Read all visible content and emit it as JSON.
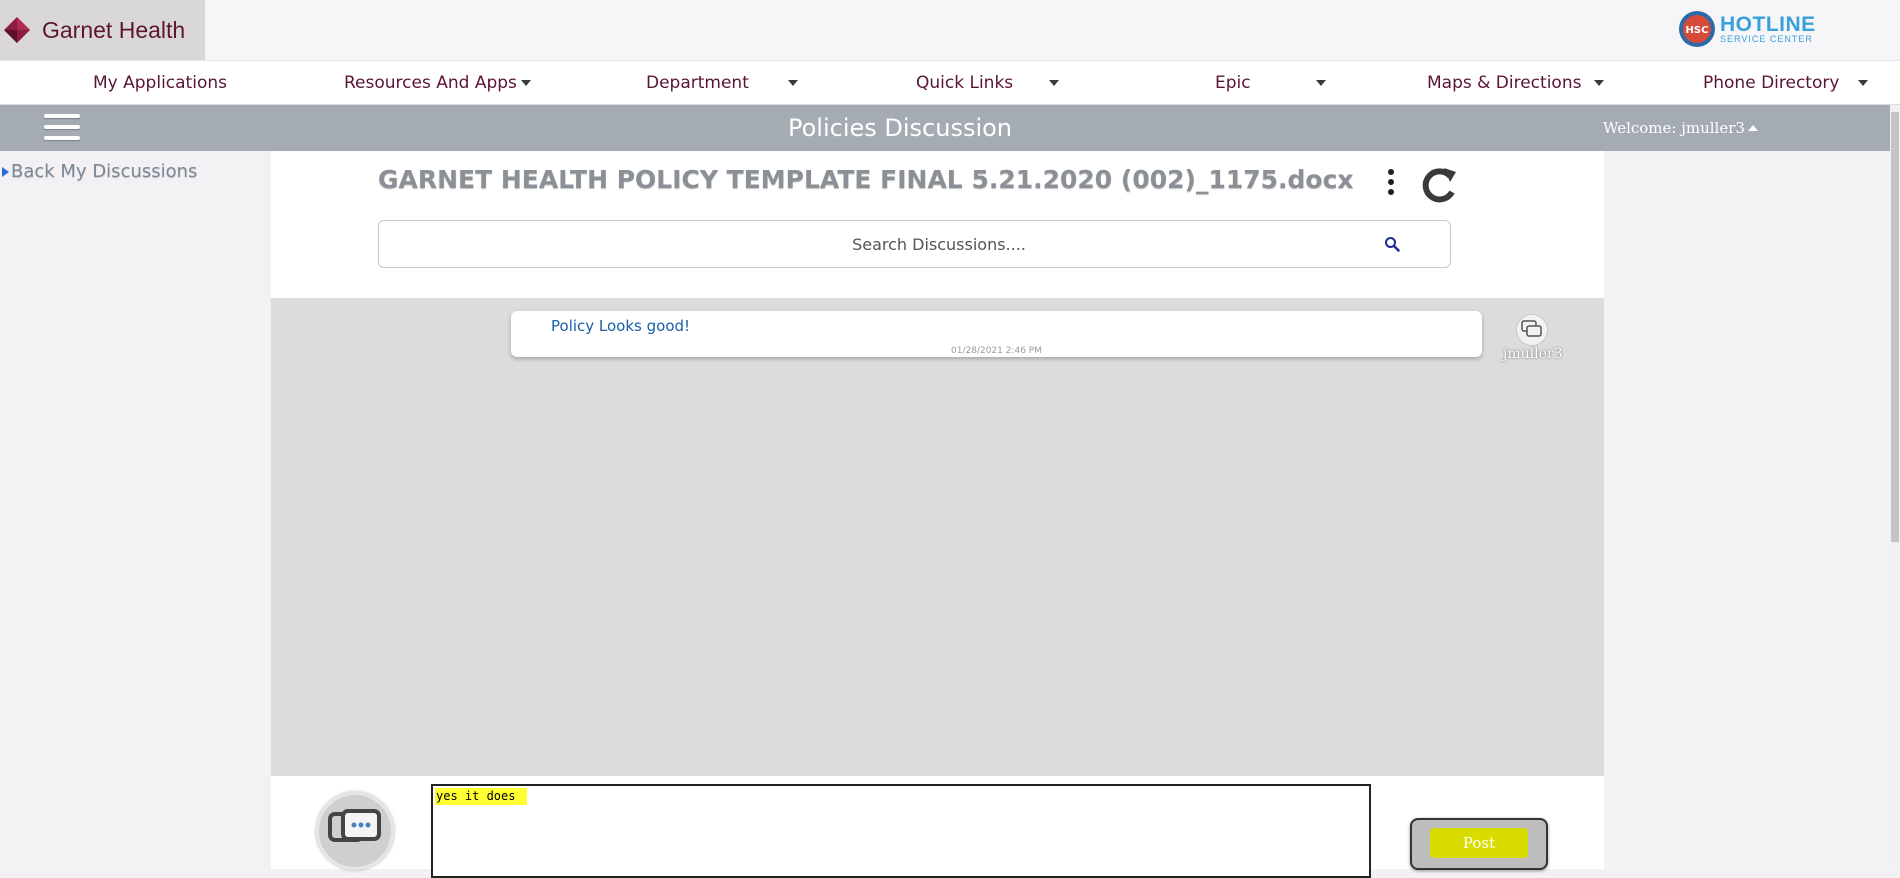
{
  "brand": {
    "logo_text": "Garnet Health",
    "logo_color": "#5c1630"
  },
  "hotline": {
    "title": "HOTLINE",
    "subtitle": "SERVICE CENTER",
    "badge": "HSC"
  },
  "nav": {
    "items": [
      {
        "label": "My Applications"
      },
      {
        "label": "Resources And Apps"
      },
      {
        "label": "Department"
      },
      {
        "label": "Quick Links"
      },
      {
        "label": "Epic"
      },
      {
        "label": "Maps & Directions"
      },
      {
        "label": "Phone Directory"
      }
    ]
  },
  "header": {
    "title": "Policies Discussion",
    "welcome": "Welcome: jmuller3"
  },
  "sidebar": {
    "back_label": "Back My Discussions"
  },
  "document": {
    "title": "GARNET HEALTH POLICY TEMPLATE FINAL 5.21.2020 (002)_1175.docx"
  },
  "search": {
    "placeholder": "Search Discussions...."
  },
  "messages": [
    {
      "text": "Policy Looks good!",
      "timestamp": "01/28/2021 2:46 PM",
      "user": "jmuller3"
    }
  ],
  "compose": {
    "value": "yes it does",
    "post_label": "Post"
  },
  "colors": {
    "accent": "#5a1436",
    "titlebar": "#a4abb2",
    "link": "#1a5fa8",
    "post_highlight": "#d8dc00"
  }
}
